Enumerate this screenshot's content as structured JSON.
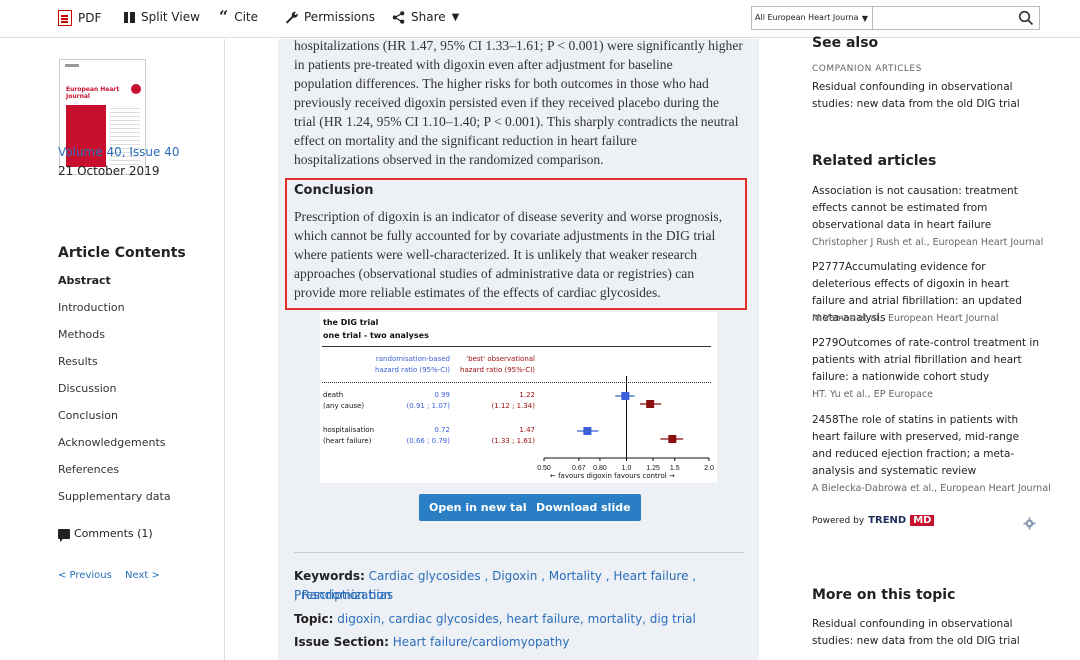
{
  "toolbar": {
    "pdf": "PDF",
    "split_view": "Split View",
    "cite": "Cite",
    "permissions": "Permissions",
    "share": "Share",
    "search_scope": "All European Heart Journa",
    "search_placeholder": ""
  },
  "left": {
    "cover_title": "European Heart Journal",
    "volume": "Volume 40, Issue 40",
    "date": "21 October 2019",
    "contents_title": "Article Contents",
    "contents": [
      "Abstract",
      "Introduction",
      "Methods",
      "Results",
      "Discussion",
      "Conclusion",
      "Acknowledgements",
      "References",
      "Supplementary data"
    ],
    "comments": "Comments (1)",
    "previous": "< Previous",
    "next": "Next >"
  },
  "article": {
    "body_lines": [
      "hospitalizations (HR 1.47, 95% CI 1.33–1.61; P < 0.001) were significantly higher",
      "in patients pre-treated with digoxin even after adjustment for baseline",
      "population differences. The higher risks for both outcomes in those who had",
      "previously received digoxin persisted even if they received placebo during the",
      "trial (HR 1.24, 95% CI 1.10–1.40; P < 0.001). This sharply contradicts the neutral",
      "effect on mortality and the significant reduction in heart failure",
      "hospitalizations observed in the randomized comparison."
    ],
    "conclusion_heading": "Conclusion",
    "conclusion_lines": [
      "Prescription of digoxin is an indicator of disease severity and worse prognosis,",
      "which cannot be fully accounted for by covariate adjustments in the DIG trial",
      "where patients were well-characterized. It is unlikely that weaker research",
      "approaches (observational studies of administrative data or registries) can",
      "provide more reliable estimates of the effects of cardiac glycosides."
    ],
    "open_tab": "Open in new tab",
    "download_slide": "Download slide",
    "keywords_label": "Keywords:",
    "keywords": "Cardiac glycosides , Digoxin , Mortality , Heart failure , Prescription bias",
    "keywords_cont": ", Randomization",
    "topic_label": "Topic:",
    "topics": "digoxin, cardiac glycosides, heart failure, mortality, dig trial",
    "issue_label": "Issue Section:",
    "issue_section": "Heart failure/cardiomyopathy"
  },
  "figure": {
    "title1": "the DIG trial",
    "title2": "one trial - two analyses",
    "hdr_rand": [
      "randomisation-based",
      "hazard ratio (95%-CI)"
    ],
    "hdr_obs": [
      "'best' observational",
      "hazard ratio (95%-CI)"
    ],
    "rows": [
      {
        "label": [
          "death",
          "(any cause)"
        ],
        "rand_hr": "0.99",
        "rand_ci": "(0.91 ; 1.07)",
        "obs_hr": "1.22",
        "obs_ci": "(1.12 ; 1.34)"
      },
      {
        "label": [
          "hospitalisation",
          "(heart failure)"
        ],
        "rand_hr": "0.72",
        "rand_ci": "(0.66 ; 0.79)",
        "obs_hr": "1.47",
        "obs_ci": "(1.33 ; 1.61)"
      }
    ],
    "favours": "← favours digoxin   favours control →",
    "colors": {
      "randomised": "#3a5fd8",
      "observational": "#8b0f0f"
    }
  },
  "chart_data": {
    "type": "scatter",
    "title": "the DIG trial",
    "subtitle": "one trial - two analyses",
    "x_scale": "log",
    "xlim": [
      0.5,
      2.0
    ],
    "x_ticks": [
      0.5,
      0.67,
      0.8,
      1.0,
      1.25,
      1.5,
      2.0
    ],
    "x_tick_labels": [
      "0.50",
      "0.67",
      "0.80",
      "1.0",
      "1.25",
      "1.5",
      "2.0"
    ],
    "categories": [
      "death (any cause)",
      "hospitalisation (heart failure)"
    ],
    "series": [
      {
        "name": "randomisation-based hazard ratio (95%-CI)",
        "values": [
          0.99,
          0.72
        ],
        "ci_low": [
          0.91,
          0.66
        ],
        "ci_high": [
          1.07,
          0.79
        ],
        "color": "#3a5fd8"
      },
      {
        "name": "'best' observational hazard ratio (95%-CI)",
        "values": [
          1.22,
          1.47
        ],
        "ci_low": [
          1.12,
          1.33
        ],
        "ci_high": [
          1.34,
          1.61
        ],
        "color": "#8b0f0f"
      }
    ]
  },
  "right": {
    "see_also": "See also",
    "companion": "COMPANION ARTICLES",
    "companion_link": "Residual confounding in observational studies: new data from the old DIG trial",
    "related_title": "Related articles",
    "related": [
      {
        "title": "Association is not causation: treatment effects cannot be estimated from observational data in heart failure",
        "authors": "Christopher J Rush et al., European Heart Journal"
      },
      {
        "title": "P2777Accumulating evidence for deleterious effects of digoxin in heart failure and atrial fibrillation: an updated meta-analysis",
        "authors": "M Vamos et al., European Heart Journal"
      },
      {
        "title": "P279Outcomes of rate-control treatment in patients with atrial fibrillation and heart failure: a nationwide cohort study",
        "authors": "HT. Yu et al., EP Europace"
      },
      {
        "title": "2458The role of statins in patients with heart failure with preserved, mid-range and reduced ejection fraction; a meta-analysis and systematic review",
        "authors": "A Bielecka-Dabrowa et al., European Heart Journal"
      }
    ],
    "powered_by": "Powered by",
    "trend": "TREND",
    "md": "MD",
    "more_title": "More on this topic",
    "more_link": "Residual confounding in observational studies: new data from the old DIG trial"
  }
}
